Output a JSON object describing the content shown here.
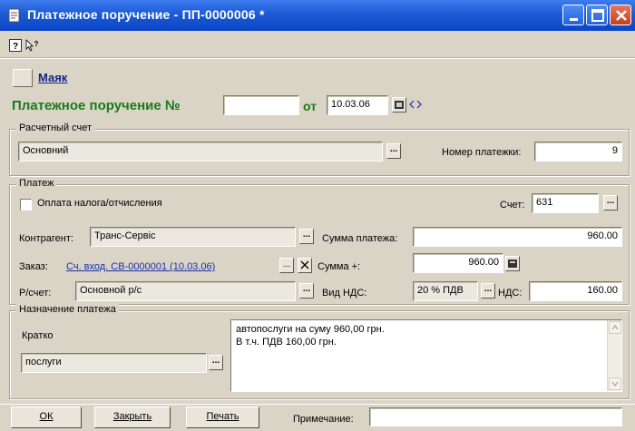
{
  "window": {
    "title": "Платежное поручение - ПП-0000006 *"
  },
  "organization": {
    "name": "Маяк"
  },
  "document": {
    "title": "Платежное поручение №",
    "number": "",
    "date_label": "от",
    "date": "10.03.06"
  },
  "account_group": {
    "title": "Расчетный счет",
    "account": "Основний",
    "payment_number_label": "Номер платежки:",
    "payment_number": "9"
  },
  "payment_group": {
    "title": "Платеж",
    "tax_checkbox_label": "Оплата налога/отчисления",
    "tax_checkbox_checked": false,
    "account_label": "Счет:",
    "account_value": "631",
    "contractor_label": "Контрагент:",
    "contractor_value": "Транс-Сервіс",
    "amount_label": "Сумма платежа:",
    "amount_value": "960.00",
    "order_label": "Заказ:",
    "order_link": "Сч. вход. СВ-0000001 (10.03.06)",
    "sum_plus_label": "Сумма +:",
    "sum_plus_value": "960.00",
    "current_account_label": "Р/счет:",
    "current_account_value": "Основной р/с",
    "vat_type_label": "Вид НДС:",
    "vat_type_value": "20 % ПДВ",
    "vat_label": "НДС:",
    "vat_value": "160.00"
  },
  "purpose_group": {
    "title": "Назначение платежа",
    "brief_label": "Кратко",
    "brief_value": "послуги",
    "text_line1": "автопослуги на суму 960,00 грн.",
    "text_line2": "В т.ч. ПДВ 160,00 грн."
  },
  "buttons": {
    "ok": "ОК",
    "close": "Закрыть",
    "print": "Печать"
  },
  "note": {
    "label": "Примечание:",
    "value": ""
  },
  "colors": {
    "title_bar": "#1d5bd6",
    "doc_title_green": "#1b7a1b",
    "link_blue": "#1a2fa8",
    "window_bg": "#d9d4c6"
  }
}
